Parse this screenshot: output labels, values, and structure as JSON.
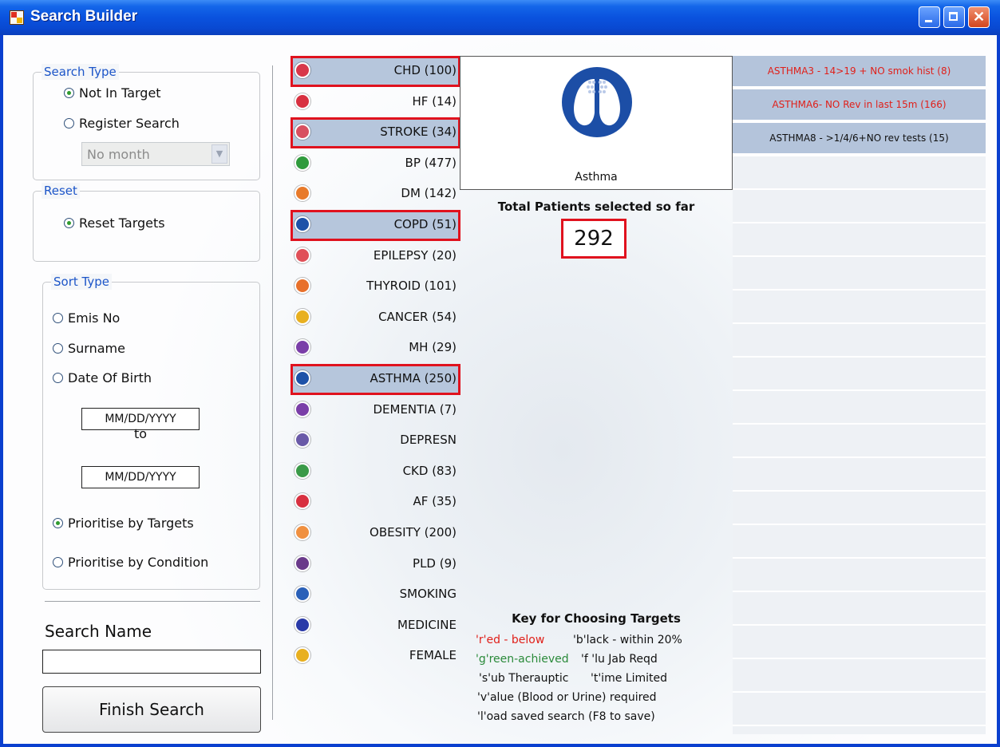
{
  "window": {
    "title": "Search Builder"
  },
  "search_type": {
    "title": "Search Type",
    "options": [
      {
        "label": "Not In Target",
        "selected": true
      },
      {
        "label": "Register Search",
        "selected": false
      }
    ],
    "month_select": {
      "value": "No month"
    }
  },
  "reset": {
    "title": "Reset",
    "option": {
      "label": "Reset Targets",
      "selected": true
    }
  },
  "sort_type": {
    "title": "Sort Type",
    "options": [
      {
        "label": "Emis No",
        "selected": false
      },
      {
        "label": "Surname",
        "selected": false
      },
      {
        "label": "Date Of Birth",
        "selected": false
      }
    ],
    "date_from_placeholder": "MM/DD/YYYY",
    "to_label": "to",
    "date_to_placeholder": "MM/DD/YYYY",
    "priority_options": [
      {
        "label": "Prioritise by Targets",
        "selected": true
      },
      {
        "label": "Prioritise by Condition",
        "selected": false
      }
    ]
  },
  "search_name": {
    "label": "Search Name",
    "value": ""
  },
  "finish_button": "Finish Search",
  "conditions": [
    {
      "label": "CHD (100)",
      "icon": "heart-icon",
      "color": "#d8384a",
      "selected": true,
      "highlighted": true
    },
    {
      "label": "HF (14)",
      "icon": "heart-failure-icon",
      "color": "#d83040",
      "selected": false,
      "highlighted": false
    },
    {
      "label": "STROKE (34)",
      "icon": "brain-icon",
      "color": "#d85060",
      "selected": true,
      "highlighted": true
    },
    {
      "label": "BP (477)",
      "icon": "blood-pressure-icon",
      "color": "#2f9a3c",
      "selected": false,
      "highlighted": false
    },
    {
      "label": "DM (142)",
      "icon": "diabetes-icon",
      "color": "#e87a2a",
      "selected": false,
      "highlighted": false
    },
    {
      "label": "COPD (51)",
      "icon": "lungs-icon",
      "color": "#1e52a8",
      "selected": true,
      "highlighted": true
    },
    {
      "label": "EPILEPSY (20)",
      "icon": "epilepsy-icon",
      "color": "#e05058",
      "selected": false,
      "highlighted": false
    },
    {
      "label": "THYROID (101)",
      "icon": "thyroid-icon",
      "color": "#e8702a",
      "selected": false,
      "highlighted": false
    },
    {
      "label": "CANCER (54)",
      "icon": "radiation-icon",
      "color": "#e8b020",
      "selected": false,
      "highlighted": false
    },
    {
      "label": "MH (29)",
      "icon": "mental-health-icon",
      "color": "#7a3ea8",
      "selected": false,
      "highlighted": false
    },
    {
      "label": "ASTHMA (250)",
      "icon": "lungs-icon",
      "color": "#1e52a8",
      "selected": true,
      "highlighted": true
    },
    {
      "label": "DEMENTIA (7)",
      "icon": "dementia-icon",
      "color": "#7a3ea8",
      "selected": false,
      "highlighted": false
    },
    {
      "label": "DEPRESN",
      "icon": "depression-icon",
      "color": "#6a5aa8",
      "selected": false,
      "highlighted": false
    },
    {
      "label": "CKD (83)",
      "icon": "kidney-icon",
      "color": "#3a9a48",
      "selected": false,
      "highlighted": false
    },
    {
      "label": "AF (35)",
      "icon": "heart-rhythm-icon",
      "color": "#d83040",
      "selected": false,
      "highlighted": false
    },
    {
      "label": "OBESITY (200)",
      "icon": "obesity-icon",
      "color": "#f09040",
      "selected": false,
      "highlighted": false
    },
    {
      "label": "PLD (9)",
      "icon": "iq-icon",
      "color": "#6a3a8a",
      "selected": false,
      "highlighted": false
    },
    {
      "label": "SMOKING",
      "icon": "smoking-icon",
      "color": "#2a60b8",
      "selected": false,
      "highlighted": false
    },
    {
      "label": "MEDICINE",
      "icon": "medicine-icon",
      "color": "#2a3aa8",
      "selected": false,
      "highlighted": false
    },
    {
      "label": "FEMALE",
      "icon": "female-icon",
      "color": "#e8b020",
      "selected": false,
      "highlighted": false
    }
  ],
  "selected_condition": {
    "name": "Asthma",
    "icon": "asthma-lungs-icon",
    "color": "#1c4ea6"
  },
  "total": {
    "label": "Total Patients selected so far",
    "value": "292"
  },
  "key": {
    "title": "Key for Choosing Targets",
    "items": [
      {
        "text": "'r'ed - below",
        "color": "#e0201a"
      },
      {
        "text": "'b'lack - within 20%",
        "color": "#111111"
      },
      {
        "text": "'g'reen-achieved",
        "color": "#2a8a3a"
      },
      {
        "text": "'f 'lu Jab Reqd",
        "color": "#111111"
      },
      {
        "text": "'s'ub Therauptic",
        "color": "#111111"
      },
      {
        "text": "'t'ime Limited",
        "color": "#111111"
      },
      {
        "text": "'v'alue (Blood or Urine) required",
        "color": "#111111"
      },
      {
        "text": "'l'oad saved search (F8 to save)",
        "color": "#111111"
      }
    ]
  },
  "targets": [
    {
      "label": "ASTHMA3 - 14>19 + NO smok hist (8)",
      "color": "#e0201a"
    },
    {
      "label": "ASTHMA6- NO Rev in last 15m (166)",
      "color": "#e0201a"
    },
    {
      "label": "ASTHMA8 - >1/4/6+NO rev tests (15)",
      "color": "#111111"
    }
  ],
  "colors": {
    "highlight": "#e0121e",
    "selected_row": "#b6c6dc",
    "group_title": "#1c55c8"
  }
}
